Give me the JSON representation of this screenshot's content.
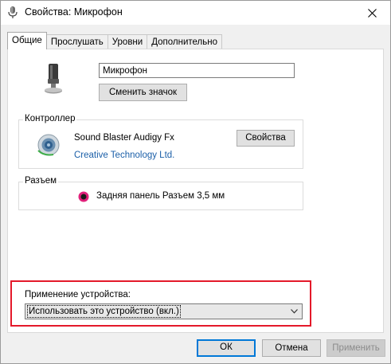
{
  "window": {
    "title": "Свойства: Микрофон"
  },
  "icons": {
    "title": "microphone-icon",
    "close": "close-icon",
    "device": "microphone-icon",
    "controller": "speaker-icon",
    "jack": "jack-icon",
    "dropdown": "chevron-down-icon"
  },
  "tabs": [
    {
      "label": "Общие",
      "active": true
    },
    {
      "label": "Прослушать",
      "active": false
    },
    {
      "label": "Уровни",
      "active": false
    },
    {
      "label": "Дополнительно",
      "active": false
    }
  ],
  "device": {
    "name": "Микрофон",
    "change_icon_label": "Сменить значок"
  },
  "controller": {
    "group_label": "Контроллер",
    "name": "Sound Blaster Audigy Fx",
    "vendor": "Creative Technology Ltd.",
    "properties_label": "Свойства"
  },
  "jack": {
    "group_label": "Разъем",
    "description": "Задняя панель Разъем 3,5 мм",
    "color": "#e0207a"
  },
  "usage": {
    "label": "Применение устройства:",
    "selected": "Использовать это устройство (вкл.)",
    "highlight_color": "#e4192a"
  },
  "footer": {
    "ok_label": "ОК",
    "cancel_label": "Отмена",
    "apply_label": "Применить"
  },
  "colors": {
    "accent": "#0078d7",
    "link": "#1b5fa8"
  }
}
